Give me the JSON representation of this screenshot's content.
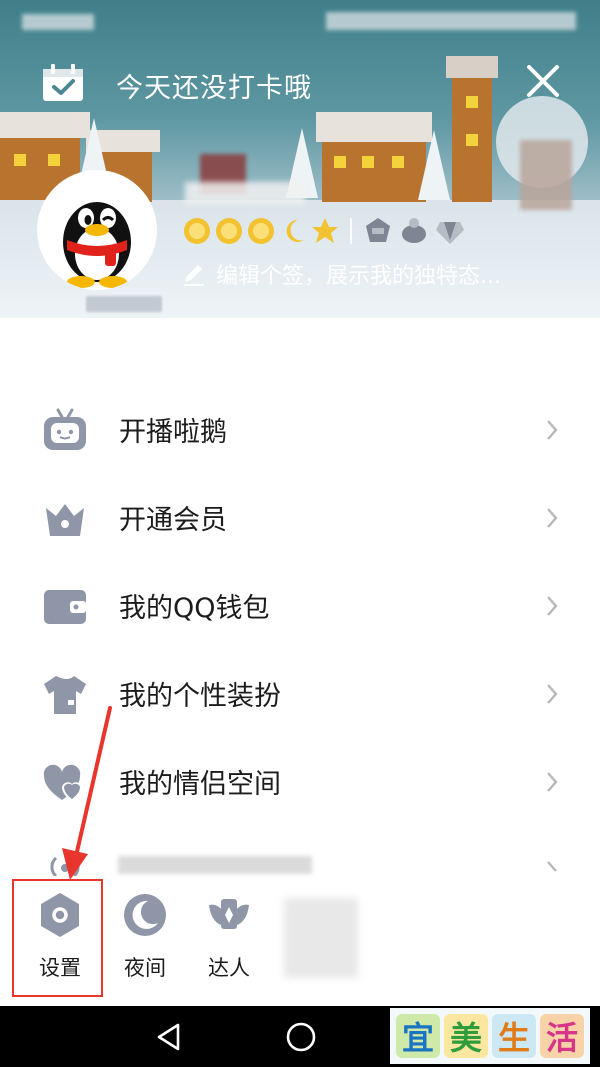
{
  "header": {
    "checkin_text": "今天还没打卡哦",
    "signature_placeholder": "编辑个签，展示我的独特态..."
  },
  "menu": {
    "items": [
      {
        "label": "开播啦鹅",
        "icon": "tv-robot-icon"
      },
      {
        "label": "开通会员",
        "icon": "crown-icon"
      },
      {
        "label": "我的QQ钱包",
        "icon": "wallet-icon"
      },
      {
        "label": "我的个性装扮",
        "icon": "tshirt-icon"
      },
      {
        "label": "我的情侣空间",
        "icon": "heart-icon"
      }
    ]
  },
  "shortcuts": [
    {
      "label": "设置",
      "icon": "settings-hexagon-icon"
    },
    {
      "label": "夜间",
      "icon": "moon-icon"
    },
    {
      "label": "达人",
      "icon": "wings-badge-icon"
    }
  ],
  "watermark": [
    "宜",
    "美",
    "生",
    "活"
  ],
  "colors": {
    "icon_gray": "#8e96a8",
    "annotation_red": "#e8362f",
    "text_dark": "#1c1c1c"
  }
}
